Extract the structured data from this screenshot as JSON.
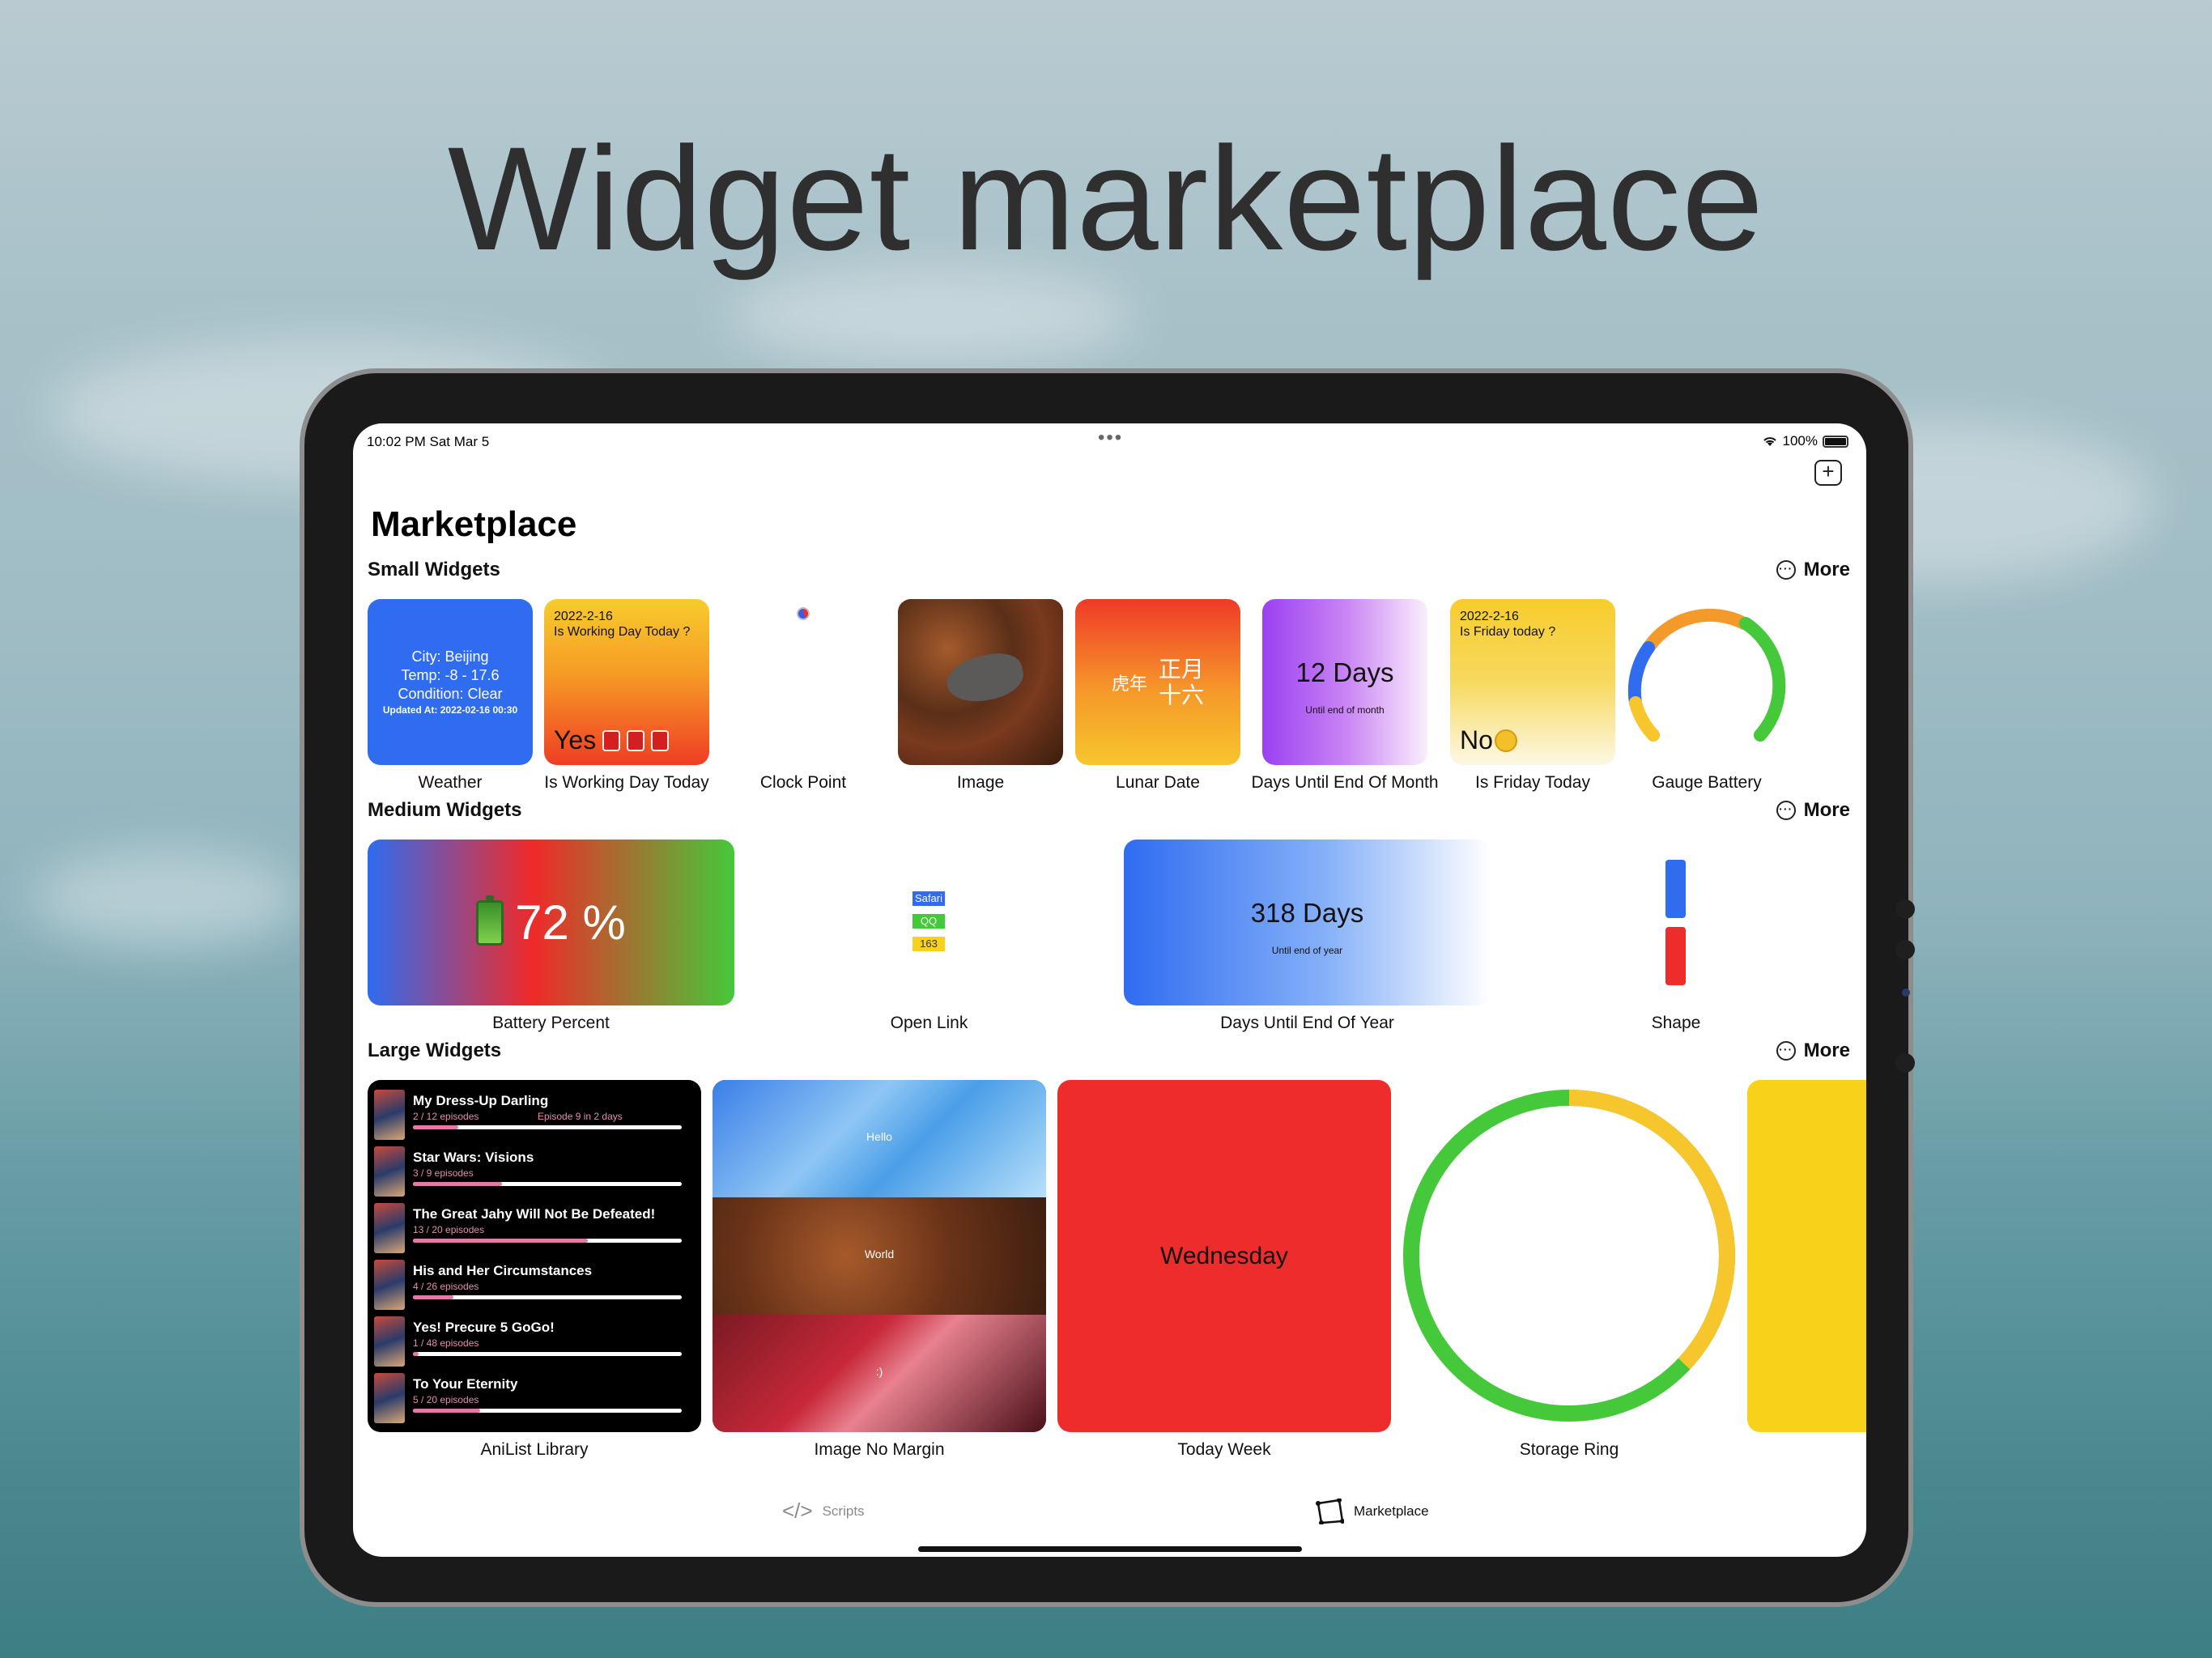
{
  "headline": "Widget marketplace",
  "status_bar": {
    "time": "10:02 PM   Sat Mar 5",
    "dots": "•••",
    "battery_text": "100%"
  },
  "page": {
    "title": "Marketplace"
  },
  "sections": {
    "small": {
      "title": "Small Widgets",
      "more": "More"
    },
    "medium": {
      "title": "Medium Widgets",
      "more": "More"
    },
    "large": {
      "title": "Large Widgets",
      "more": "More"
    }
  },
  "small_widgets": [
    {
      "caption": "Weather",
      "lines": [
        "City: Beijing",
        "Temp: -8 - 17.6",
        "Condition: Clear"
      ],
      "updated": "Updated At: 2022-02-16 00:30"
    },
    {
      "caption": "Is Working Day Today",
      "date": "2022-2-16",
      "question": "Is Working Day Today ?",
      "answer": "Yes"
    },
    {
      "caption": "Clock Point"
    },
    {
      "caption": "Image"
    },
    {
      "caption": "Lunar Date",
      "year": "虎年",
      "month": "正月",
      "day": "十六"
    },
    {
      "caption": "Days Until End Of Month",
      "value": "12 Days",
      "sub": "Until end of month"
    },
    {
      "caption": "Is Friday Today",
      "date": "2022-2-16",
      "question": "Is Friday today ?",
      "answer": "No"
    },
    {
      "caption": "Gauge Battery"
    }
  ],
  "medium_widgets": [
    {
      "caption": "Battery Percent",
      "value": "72 %"
    },
    {
      "caption": "Open Link",
      "chips": [
        "Safari",
        "QQ",
        "163"
      ]
    },
    {
      "caption": "Days Until End Of Year",
      "value": "318 Days",
      "sub": "Until end of year"
    },
    {
      "caption": "Shape"
    }
  ],
  "large_widgets": [
    {
      "caption": "AniList Library"
    },
    {
      "caption": "Image No Margin",
      "bands": [
        "Hello",
        "World",
        ":)"
      ]
    },
    {
      "caption": "Today Week",
      "value": "Wednesday"
    },
    {
      "caption": "Storage Ring"
    }
  ],
  "anilist": [
    {
      "title": "My Dress-Up Darling",
      "episodes": "2 / 12 episodes",
      "next": "Episode 9 in 2 days",
      "progress": 0.17
    },
    {
      "title": "Star Wars: Visions",
      "episodes": "3 / 9 episodes",
      "next": "",
      "progress": 0.33
    },
    {
      "title": "The Great Jahy Will Not Be Defeated!",
      "episodes": "13 / 20 episodes",
      "next": "",
      "progress": 0.65
    },
    {
      "title": "His and Her Circumstances",
      "episodes": "4 / 26 episodes",
      "next": "",
      "progress": 0.15
    },
    {
      "title": "Yes! Precure 5 GoGo!",
      "episodes": "1 / 48 episodes",
      "next": "",
      "progress": 0.02
    },
    {
      "title": "To Your Eternity",
      "episodes": "5 / 20 episodes",
      "next": "",
      "progress": 0.25
    }
  ],
  "gauge_levels": {
    "blue": 0.15,
    "orange": 0.25,
    "green": 0.3
  },
  "storage_ring": {
    "used_fraction": 0.37
  },
  "tabs": {
    "scripts": "Scripts",
    "marketplace": "Marketplace"
  },
  "colors": {
    "blue": "#2f6cf0",
    "red": "#ef2c2c",
    "green": "#45c83a",
    "yellow": "#f7d11a"
  }
}
